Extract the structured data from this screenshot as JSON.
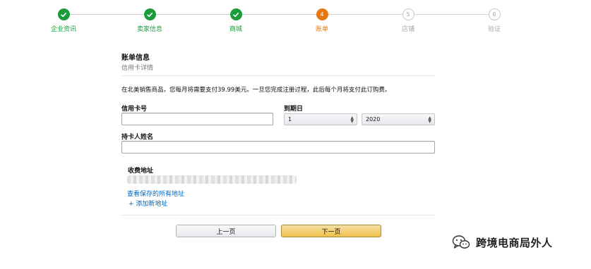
{
  "stepper": {
    "steps": [
      {
        "label": "企业资讯",
        "state": "done",
        "number": "1"
      },
      {
        "label": "卖家信息",
        "state": "done",
        "number": "2"
      },
      {
        "label": "商城",
        "state": "done",
        "number": "3"
      },
      {
        "label": "账单",
        "state": "active",
        "number": "4"
      },
      {
        "label": "店铺",
        "state": "pending",
        "number": "5"
      },
      {
        "label": "验证",
        "state": "pending",
        "number": "6"
      }
    ],
    "done_icon": "checkmark-icon",
    "colors": {
      "done": "#1a9c3b",
      "active": "#e47911",
      "pending": "#a8a8a8"
    }
  },
  "billing": {
    "title": "账单信息",
    "subtitle": "信用卡详情",
    "notice": "在北美销售商品，您每月将需要支付39.99美元。一旦您完成注册过程，此后每个月将支付此订购费。"
  },
  "form": {
    "card_number_label": "信用卡号",
    "card_number_value": "",
    "expiry_label": "到期日",
    "expiry_month": "1",
    "expiry_year": "2020",
    "holder_label": "持卡人姓名",
    "holder_value": ""
  },
  "address": {
    "title": "收费地址",
    "view_all_link": "查看保存的所有地址",
    "add_new_link": "+ 添加新地址"
  },
  "buttons": {
    "prev_label": "上一页",
    "next_label": "下一页"
  },
  "watermark": {
    "text": "跨境电商局外人",
    "icon": "wechat-icon"
  }
}
